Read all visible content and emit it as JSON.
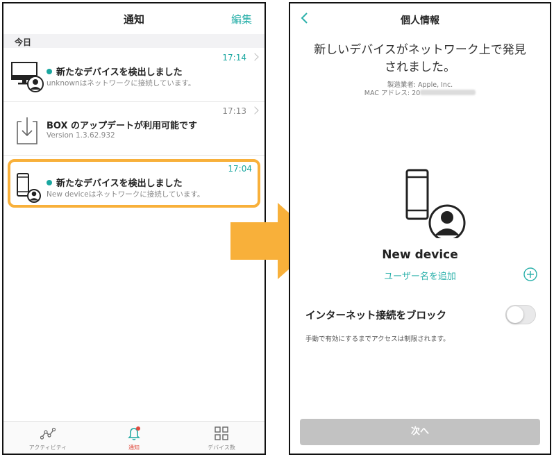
{
  "left": {
    "header": {
      "title": "通知",
      "edit": "編集"
    },
    "section": "今日",
    "items": [
      {
        "time": "17:14",
        "title": "新たなデバイスを検出しました",
        "sub": "unknownはネットワークに接続しています。",
        "icon": "monitor-user-icon",
        "unread": true
      },
      {
        "time": "17:13",
        "title": "BOX のアップデートが利用可能です",
        "sub": "Version 1.3.62.932",
        "icon": "download-icon",
        "unread": false
      },
      {
        "time": "17:04",
        "title": "新たなデバイスを検出しました",
        "sub": "New deviceはネットワークに接続しています。",
        "icon": "phone-user-icon",
        "unread": true
      }
    ],
    "tabs": [
      {
        "label": "アクティビティ",
        "icon": "activity-icon"
      },
      {
        "label": "通知",
        "icon": "bell-icon",
        "active": true
      },
      {
        "label": "デバイス数",
        "icon": "grid-icon"
      }
    ]
  },
  "right": {
    "header": {
      "back": "<",
      "title": "個人情報"
    },
    "headline_line1": "新しいデバイスがネットワーク上で発見",
    "headline_line2": "されました。",
    "manufacturer": "製造業者: Apple, Inc.",
    "mac_label": "MAC アドレス: 20",
    "device_name": "New device",
    "add_user": "ユーザー名を追加",
    "block_label": "インターネット接続をブロック",
    "block_enabled": false,
    "note": "手動で有効にするまでアクセスは制限されます。",
    "next": "次へ"
  },
  "colors": {
    "accent": "#2ab0aa",
    "highlight": "#f8b03a",
    "alert": "#e04b3f"
  }
}
